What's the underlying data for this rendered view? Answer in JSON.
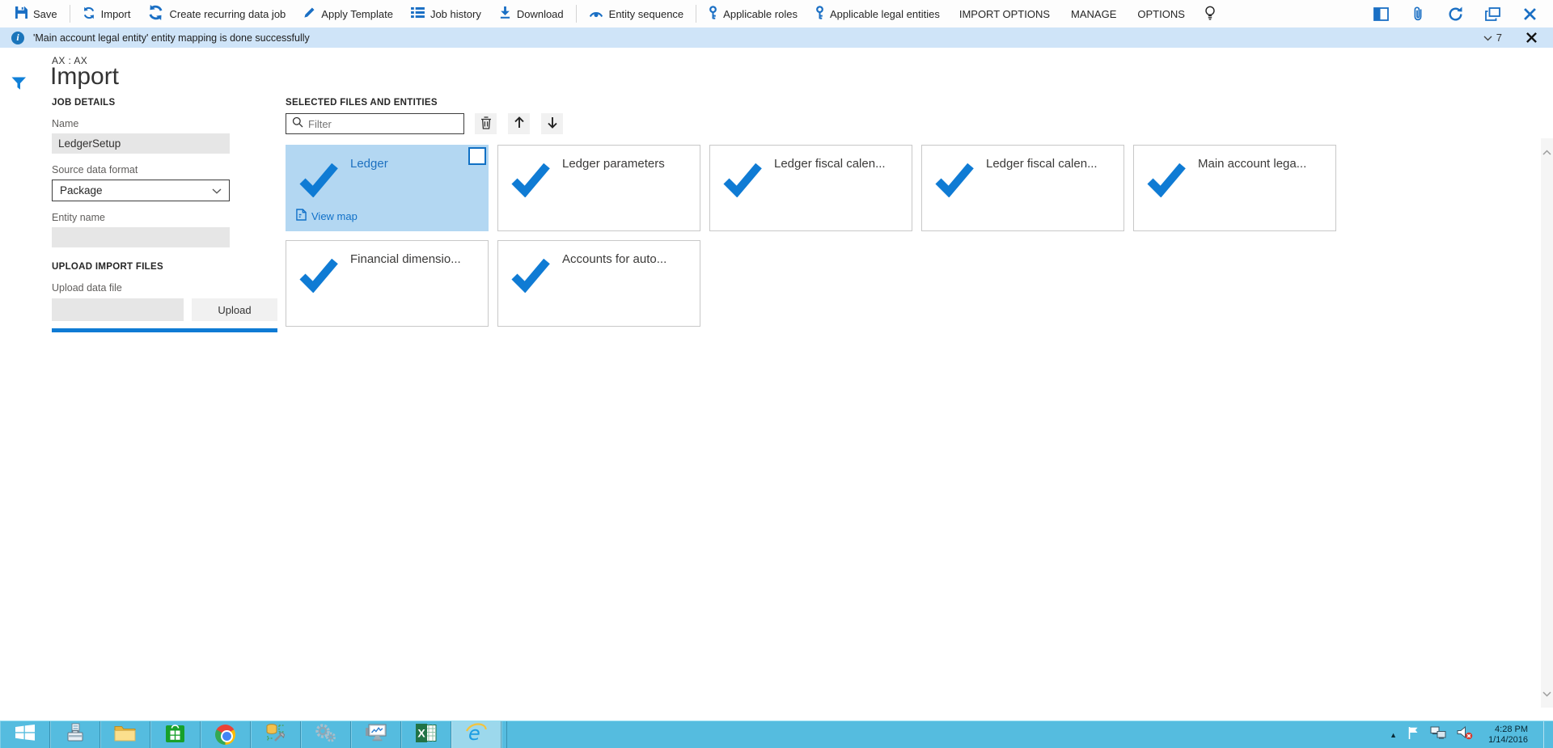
{
  "toolbar": {
    "items": [
      {
        "label": "Save"
      },
      {
        "label": "Import"
      },
      {
        "label": "Create recurring data job"
      },
      {
        "label": "Apply Template"
      },
      {
        "label": "Job history"
      },
      {
        "label": "Download"
      },
      {
        "label": "Entity sequence"
      },
      {
        "label": "Applicable roles"
      },
      {
        "label": "Applicable legal entities"
      },
      {
        "label": "IMPORT OPTIONS"
      },
      {
        "label": "MANAGE"
      },
      {
        "label": "OPTIONS"
      }
    ],
    "right_icons": [
      "side-panel-icon",
      "attachments-icon",
      "refresh-icon",
      "pop-out-icon",
      "close-icon"
    ]
  },
  "notification": {
    "message": "'Main account legal entity' entity mapping is done successfully",
    "count": "7"
  },
  "page": {
    "caption": "AX : AX",
    "title": "Import"
  },
  "job_details": {
    "heading": "JOB DETAILS",
    "name_label": "Name",
    "name_value": "LedgerSetup",
    "source_label": "Source data format",
    "source_value": "Package",
    "entity_label": "Entity name"
  },
  "upload": {
    "heading": "UPLOAD IMPORT FILES",
    "file_label": "Upload data file",
    "button_label": "Upload"
  },
  "entities": {
    "heading": "SELECTED FILES AND ENTITIES",
    "filter_placeholder": "Filter",
    "tiles": [
      {
        "label": "Ledger",
        "selected": true,
        "view_map_label": "View map"
      },
      {
        "label": "Ledger parameters"
      },
      {
        "label": "Ledger fiscal calen..."
      },
      {
        "label": "Ledger fiscal calen..."
      },
      {
        "label": "Main account lega..."
      },
      {
        "label": "Financial dimensio..."
      },
      {
        "label": "Accounts for auto..."
      }
    ]
  },
  "taskbar": {
    "apps": [
      "start",
      "server-manager",
      "file-explorer",
      "store",
      "chrome",
      "database-tools",
      "services-gears",
      "performance-monitor",
      "excel",
      "internet-explorer"
    ],
    "tray_icons": [
      "hidden-icons",
      "action-center-flag",
      "network",
      "volume-muted"
    ],
    "clock_time": "4:28 PM",
    "clock_date": "1/14/2016"
  },
  "colors": {
    "accent_blue": "#0f7bd4",
    "icon_blue": "#1a6fc4",
    "notification_bg": "#cfe4f8",
    "selected_tile_bg": "#b3d7f2",
    "taskbar_bg": "#55bcdf"
  }
}
